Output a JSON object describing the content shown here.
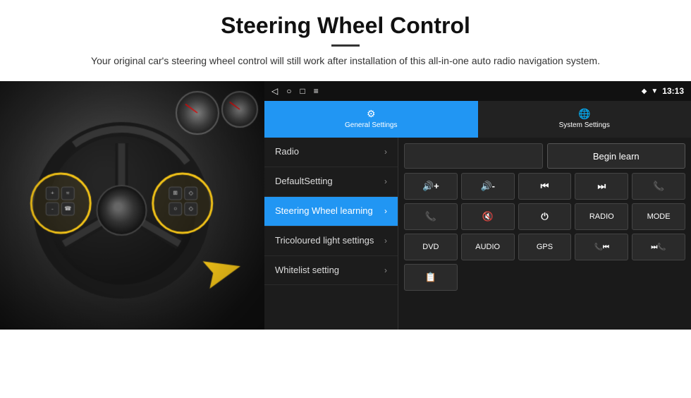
{
  "header": {
    "title": "Steering Wheel Control",
    "subtitle": "Your original car's steering wheel control will still work after installation of this all-in-one auto radio navigation system."
  },
  "android_ui": {
    "status_bar": {
      "time": "13:13",
      "nav_back": "◁",
      "nav_home": "○",
      "nav_square": "□",
      "nav_menu": "⋮"
    },
    "tabs": [
      {
        "id": "general",
        "label": "General Settings",
        "icon": "⚙",
        "active": true
      },
      {
        "id": "system",
        "label": "System Settings",
        "icon": "🌐",
        "active": false
      }
    ],
    "menu_items": [
      {
        "id": "radio",
        "label": "Radio",
        "active": false
      },
      {
        "id": "default",
        "label": "DefaultSetting",
        "active": false
      },
      {
        "id": "steering",
        "label": "Steering Wheel learning",
        "active": true
      },
      {
        "id": "tricoloured",
        "label": "Tricoloured light settings",
        "active": false
      },
      {
        "id": "whitelist",
        "label": "Whitelist setting",
        "active": false
      }
    ],
    "controls": {
      "begin_learn_label": "Begin learn",
      "buttons_row1": [
        "🔊+",
        "🔊-",
        "⏮",
        "⏭",
        "📞"
      ],
      "buttons_row2": [
        "📞",
        "🔇",
        "⏻",
        "RADIO",
        "MODE"
      ],
      "buttons_row3": [
        "DVD",
        "AUDIO",
        "GPS",
        "📞⏮",
        "⏭📞"
      ],
      "buttons_row4": [
        "📋"
      ]
    }
  }
}
